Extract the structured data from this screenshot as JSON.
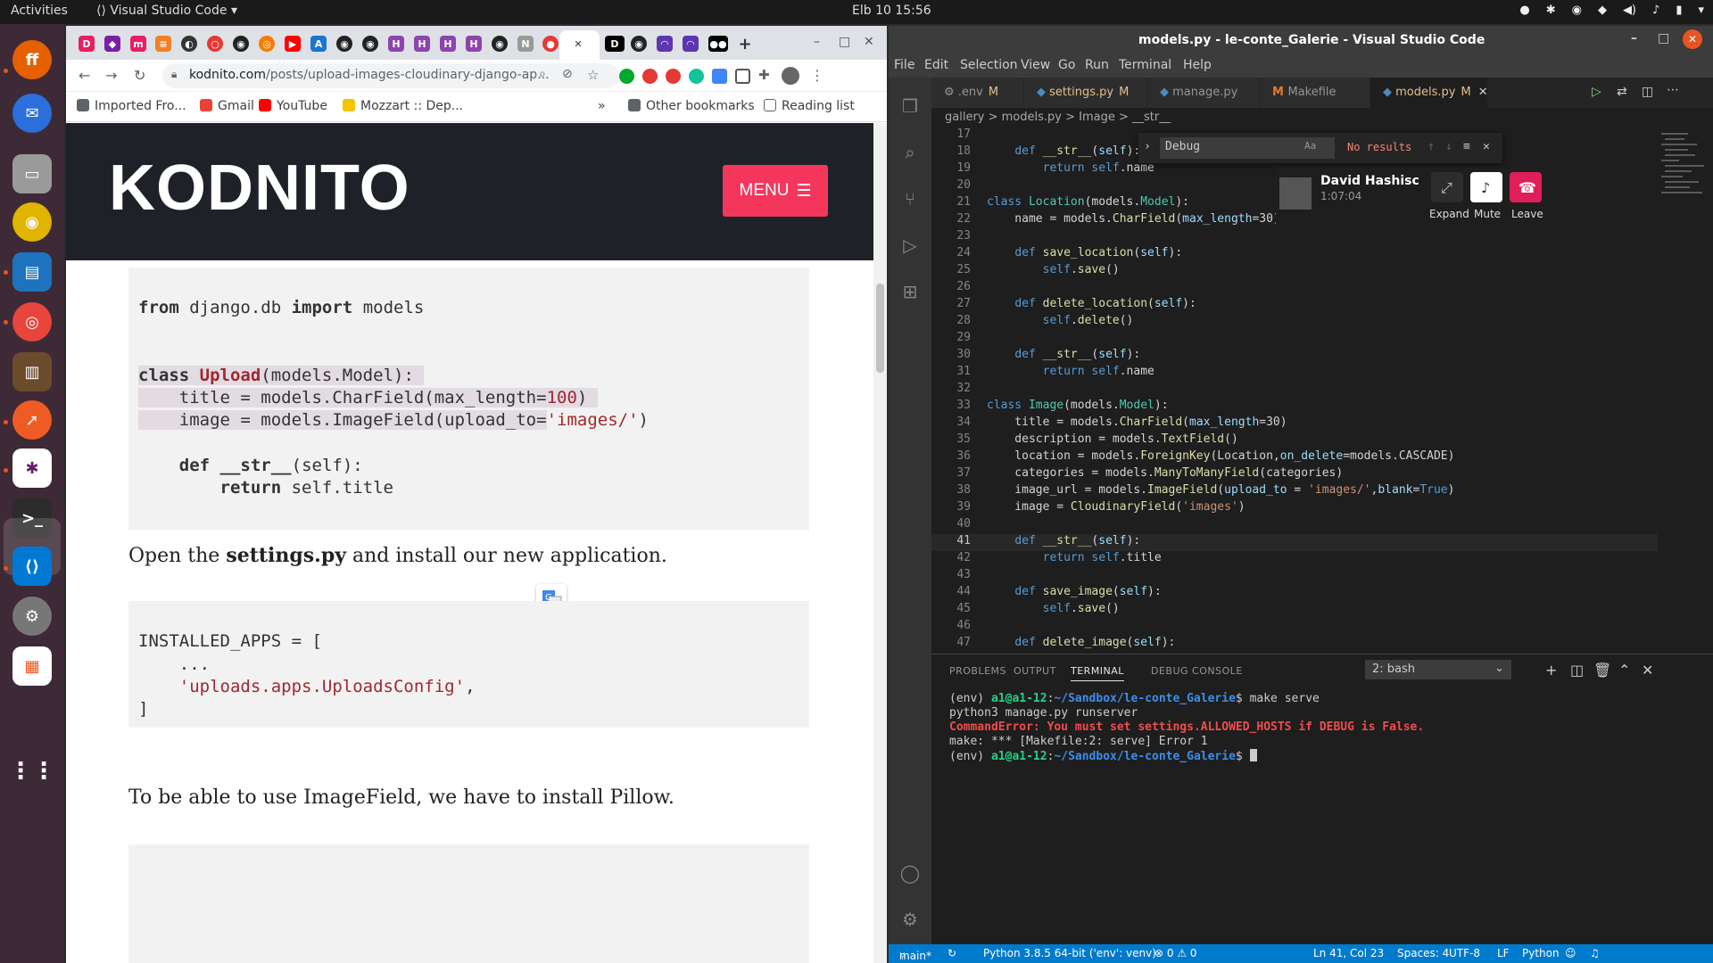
{
  "topbar": {
    "activities": "Activities",
    "app_name": "Visual Studio Code",
    "clock": "Elb 10  15:56"
  },
  "dock": {
    "items": [
      "firefox-icon",
      "thunderbird-icon",
      "files-icon",
      "rhythmbox-icon",
      "writer-icon",
      "chrome-icon",
      "calibre-icon",
      "postman-icon",
      "slack-icon",
      "terminal-icon",
      "vscode-icon",
      "settings-icon",
      "calendar-icon",
      "apps-grid-icon"
    ]
  },
  "chrome": {
    "url_host": "kodnito.com",
    "url_path": "/posts/upload-images-cloudinary-django-ap...",
    "bookmarks": [
      "Imported Fro...",
      "Gmail",
      "YouTube",
      "Mozzart :: Dep...",
      "»",
      "Other bookmarks",
      "Reading list"
    ]
  },
  "page": {
    "logo": "KODNITO",
    "menu_label": "MENU",
    "code1": {
      "l1_kw1": "from",
      "l1_mid": " django.db ",
      "l1_kw2": "import",
      "l1_end": " models",
      "l2_kw": "class",
      "l2_cls": "Upload",
      "l2_end": "(models.Model):",
      "l3_a": "    title = models.CharField(max_length=",
      "l3_num": "100",
      "l3_b": ")",
      "l4_a": "    image = models.ImageField(upload_to=",
      "l4_str": "'images/'",
      "l4_b": ")",
      "l5_kw": "def",
      "l5_fn": "__str__",
      "l5_end": "(self):",
      "l6_kw": "return",
      "l6_end": " self.title"
    },
    "para1_a": "Open the ",
    "para1_b": "settings.py",
    "para1_c": " and install our new application.",
    "code2": {
      "l1": "INSTALLED_APPS = [",
      "l2": "    ...",
      "l3_str": "'uploads.apps.UploadsConfig'",
      "l3_end": ",",
      "l4": "]"
    },
    "para2": "To be able to use ImageField, we have to install Pillow."
  },
  "vscode": {
    "title": "models.py - le-conte_Galerie - Visual Studio Code",
    "menu": [
      "File",
      "Edit",
      "Selection",
      "View",
      "Go",
      "Run",
      "Terminal",
      "Help"
    ],
    "tabs": [
      {
        "label": ".env",
        "mod": "M"
      },
      {
        "label": "settings.py",
        "mod": "M"
      },
      {
        "label": "manage.py",
        "mod": ""
      },
      {
        "label": "Makefile",
        "mod": ""
      },
      {
        "label": "models.py",
        "mod": "M"
      }
    ],
    "breadcrumbs": "gallery  >  models.py  >  Image  >  __str__",
    "find": {
      "value": "Debug",
      "result": "No results"
    },
    "call": {
      "name": "David Hashisc",
      "time": "1:07:04",
      "expand": "Expand",
      "mute": "Mute",
      "leave": "Leave"
    },
    "line_numbers": [
      "17",
      "18",
      "19",
      "20",
      "21",
      "22",
      "23",
      "24",
      "25",
      "26",
      "27",
      "28",
      "29",
      "30",
      "31",
      "32",
      "33",
      "34",
      "35",
      "36",
      "37",
      "38",
      "39",
      "40",
      "41",
      "42",
      "43",
      "44",
      "45",
      "46",
      "47"
    ],
    "panel_tabs": [
      "PROBLEMS",
      "OUTPUT",
      "TERMINAL",
      "DEBUG CONSOLE"
    ],
    "terminal_select": "2: bash",
    "terminal": {
      "l1_env": "(env) ",
      "l1_user": "a1@a1-12",
      "l1_colon": ":",
      "l1_path": "~/Sandbox/le-conte_Galerie",
      "l1_cmd": "$ make serve",
      "l2": "python3 manage.py runserver",
      "l3": "CommandError: You must set settings.ALLOWED_HOSTS if DEBUG is False.",
      "l4": "make: *** [Makefile:2: serve] Error 1",
      "l5_env": "(env) ",
      "l5_user": "a1@a1-12",
      "l5_colon": ":",
      "l5_path": "~/Sandbox/le-conte_Galerie",
      "l5_cmd": "$ "
    },
    "status": {
      "branch": "main*",
      "python": "Python 3.8.5 64-bit ('env': venv)",
      "problems": "⊗ 0 ⚠ 0",
      "position": "Ln 41, Col 23",
      "spaces": "Spaces: 4",
      "encoding": "UTF-8",
      "eol": "LF",
      "language": "Python"
    }
  }
}
